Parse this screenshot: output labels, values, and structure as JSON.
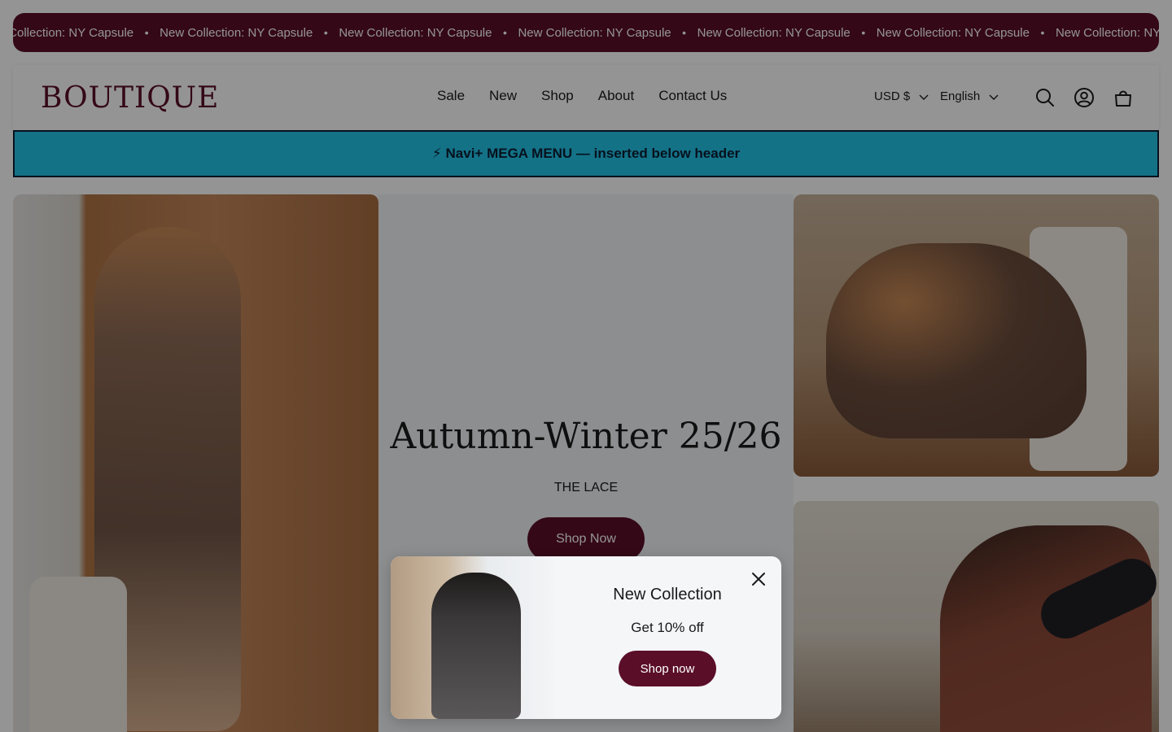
{
  "announcement": {
    "items": [
      "New Collection: NY Capsule",
      "New Collection: NY Capsule",
      "New Collection: NY Capsule",
      "New Collection: NY Capsule",
      "New Collection: NY Capsule",
      "New Collection: NY Capsule",
      "New Collection: NY Capsule"
    ],
    "separator": "•"
  },
  "header": {
    "logo": "BOUTIQUE",
    "nav": [
      "Sale",
      "New",
      "Shop",
      "About",
      "Contact Us"
    ],
    "currency": "USD $",
    "language": "English",
    "icons": [
      "search-icon",
      "account-icon",
      "cart-icon"
    ]
  },
  "mega_menu": {
    "label": "⚡ Navi+ MEGA MENU — inserted below header"
  },
  "hero": {
    "title": "Autumn-Winter 25/26",
    "subtitle": "THE LACE",
    "button": "Shop Now"
  },
  "popup": {
    "title": "New Collection",
    "text": "Get 10% off",
    "button": "Shop now"
  },
  "colors": {
    "brand": "#5a0e28",
    "mega_menu_bg": "#23c4e8",
    "mega_menu_text": "#0b1e33",
    "overlay": "rgba(0,0,0,0.42)"
  }
}
